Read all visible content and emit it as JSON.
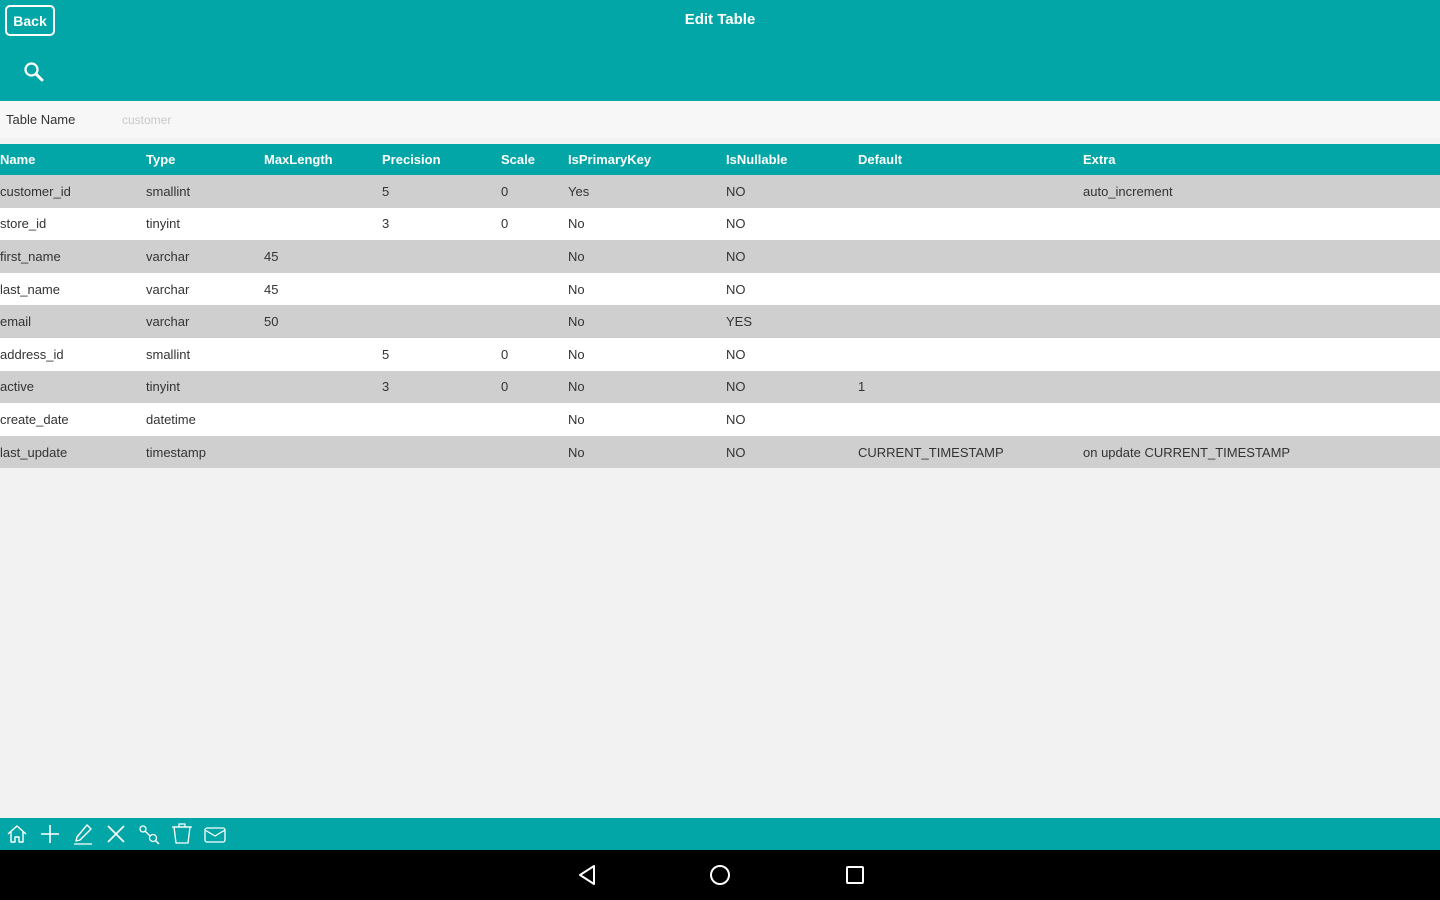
{
  "header": {
    "back_label": "Back",
    "title": "Edit Table"
  },
  "table_name": {
    "label": "Table Name",
    "value": "",
    "placeholder": "customer"
  },
  "grid": {
    "columns": [
      "Name",
      "Type",
      "MaxLength",
      "Precision",
      "Scale",
      "IsPrimaryKey",
      "IsNullable",
      "Default",
      "Extra"
    ],
    "rows": [
      [
        "customer_id",
        "smallint",
        "",
        "5",
        "0",
        "Yes",
        "NO",
        "",
        "auto_increment"
      ],
      [
        "store_id",
        "tinyint",
        "",
        "3",
        "0",
        "No",
        "NO",
        "",
        ""
      ],
      [
        "first_name",
        "varchar",
        "45",
        "",
        "",
        "No",
        "NO",
        "",
        ""
      ],
      [
        "last_name",
        "varchar",
        "45",
        "",
        "",
        "No",
        "NO",
        "",
        ""
      ],
      [
        "email",
        "varchar",
        "50",
        "",
        "",
        "No",
        "YES",
        "",
        ""
      ],
      [
        "address_id",
        "smallint",
        "",
        "5",
        "0",
        "No",
        "NO",
        "",
        ""
      ],
      [
        "active",
        "tinyint",
        "",
        "3",
        "0",
        "No",
        "NO",
        "1",
        ""
      ],
      [
        "create_date",
        "datetime",
        "",
        "",
        "",
        "No",
        "NO",
        "",
        ""
      ],
      [
        "last_update",
        "timestamp",
        "",
        "",
        "",
        "No",
        "NO",
        "CURRENT_TIMESTAMP",
        "on update CURRENT_TIMESTAMP"
      ]
    ]
  },
  "toolbar": {
    "icons": [
      "home-icon",
      "add-icon",
      "edit-icon",
      "delete-icon",
      "key-search-icon",
      "clear-icon",
      "mail-icon"
    ]
  },
  "navbar": {
    "icons": [
      "back-triangle-icon",
      "home-circle-icon",
      "recents-square-icon"
    ]
  },
  "colors": {
    "accent": "#02a6a6",
    "row_alt": "#cfcfcf",
    "row": "#ffffff",
    "background": "#f2f2f2"
  }
}
